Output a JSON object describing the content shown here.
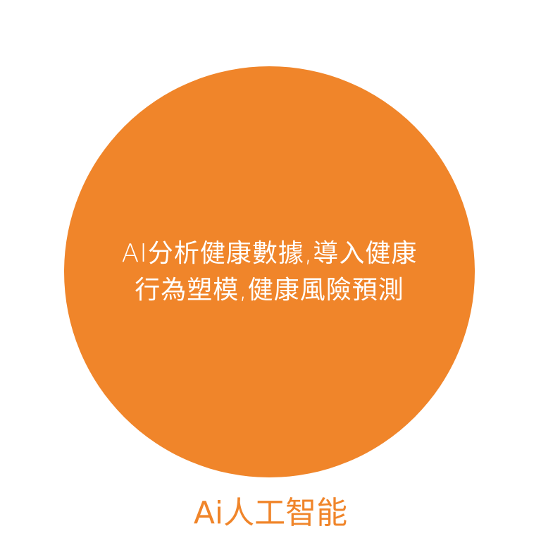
{
  "circle": {
    "line1": "AI分析健康數據,導入健康",
    "line2": "行為塑模,健康風險預測",
    "color": "#f0852a"
  },
  "caption": "Ai人工智能"
}
